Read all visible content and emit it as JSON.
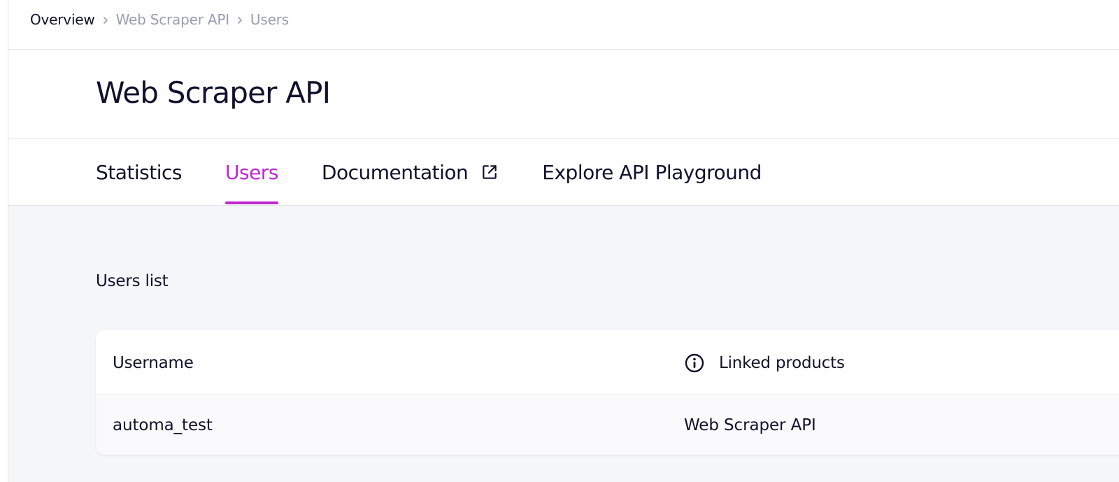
{
  "breadcrumb": {
    "items": [
      "Overview",
      "Web Scraper API",
      "Users"
    ]
  },
  "page": {
    "title": "Web Scraper API"
  },
  "tabs": [
    {
      "label": "Statistics",
      "active": false
    },
    {
      "label": "Users",
      "active": true
    },
    {
      "label": "Documentation",
      "active": false,
      "icon": "external-link-icon"
    },
    {
      "label": "Explore API Playground",
      "active": false
    }
  ],
  "users_section": {
    "title": "Users list",
    "columns": [
      "Username",
      "Linked products"
    ],
    "column_icons": {
      "linked_products": "info-icon"
    },
    "rows": [
      {
        "username": "automa_test",
        "linked_products": "Web Scraper API"
      }
    ]
  },
  "colors": {
    "accent": "#c026d3",
    "text": "#10112b",
    "muted": "#9a9db1",
    "content_bg": "#f5f6fa",
    "border": "#e2e3e8"
  }
}
